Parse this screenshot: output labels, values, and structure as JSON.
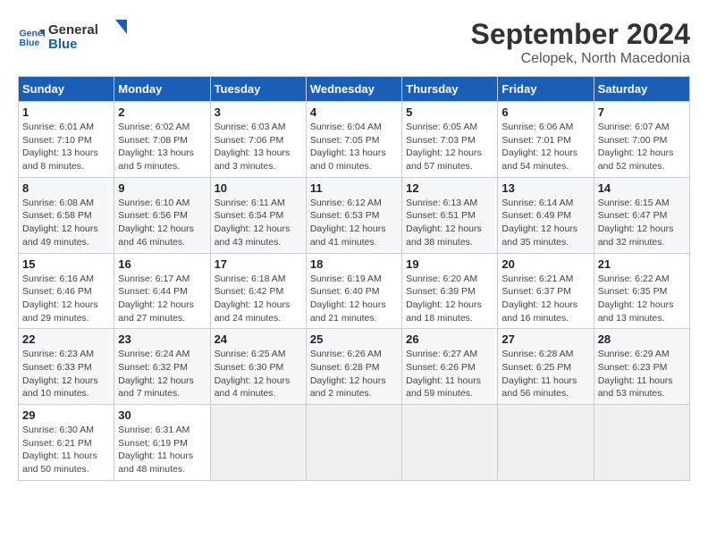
{
  "header": {
    "logo_line1": "General",
    "logo_line2": "Blue",
    "month": "September 2024",
    "location": "Celopek, North Macedonia"
  },
  "days_of_week": [
    "Sunday",
    "Monday",
    "Tuesday",
    "Wednesday",
    "Thursday",
    "Friday",
    "Saturday"
  ],
  "weeks": [
    [
      {
        "day": "1",
        "info": "Sunrise: 6:01 AM\nSunset: 7:10 PM\nDaylight: 13 hours and 8 minutes."
      },
      {
        "day": "2",
        "info": "Sunrise: 6:02 AM\nSunset: 7:08 PM\nDaylight: 13 hours and 5 minutes."
      },
      {
        "day": "3",
        "info": "Sunrise: 6:03 AM\nSunset: 7:06 PM\nDaylight: 13 hours and 3 minutes."
      },
      {
        "day": "4",
        "info": "Sunrise: 6:04 AM\nSunset: 7:05 PM\nDaylight: 13 hours and 0 minutes."
      },
      {
        "day": "5",
        "info": "Sunrise: 6:05 AM\nSunset: 7:03 PM\nDaylight: 12 hours and 57 minutes."
      },
      {
        "day": "6",
        "info": "Sunrise: 6:06 AM\nSunset: 7:01 PM\nDaylight: 12 hours and 54 minutes."
      },
      {
        "day": "7",
        "info": "Sunrise: 6:07 AM\nSunset: 7:00 PM\nDaylight: 12 hours and 52 minutes."
      }
    ],
    [
      {
        "day": "8",
        "info": "Sunrise: 6:08 AM\nSunset: 6:58 PM\nDaylight: 12 hours and 49 minutes."
      },
      {
        "day": "9",
        "info": "Sunrise: 6:10 AM\nSunset: 6:56 PM\nDaylight: 12 hours and 46 minutes."
      },
      {
        "day": "10",
        "info": "Sunrise: 6:11 AM\nSunset: 6:54 PM\nDaylight: 12 hours and 43 minutes."
      },
      {
        "day": "11",
        "info": "Sunrise: 6:12 AM\nSunset: 6:53 PM\nDaylight: 12 hours and 41 minutes."
      },
      {
        "day": "12",
        "info": "Sunrise: 6:13 AM\nSunset: 6:51 PM\nDaylight: 12 hours and 38 minutes."
      },
      {
        "day": "13",
        "info": "Sunrise: 6:14 AM\nSunset: 6:49 PM\nDaylight: 12 hours and 35 minutes."
      },
      {
        "day": "14",
        "info": "Sunrise: 6:15 AM\nSunset: 6:47 PM\nDaylight: 12 hours and 32 minutes."
      }
    ],
    [
      {
        "day": "15",
        "info": "Sunrise: 6:16 AM\nSunset: 6:46 PM\nDaylight: 12 hours and 29 minutes."
      },
      {
        "day": "16",
        "info": "Sunrise: 6:17 AM\nSunset: 6:44 PM\nDaylight: 12 hours and 27 minutes."
      },
      {
        "day": "17",
        "info": "Sunrise: 6:18 AM\nSunset: 6:42 PM\nDaylight: 12 hours and 24 minutes."
      },
      {
        "day": "18",
        "info": "Sunrise: 6:19 AM\nSunset: 6:40 PM\nDaylight: 12 hours and 21 minutes."
      },
      {
        "day": "19",
        "info": "Sunrise: 6:20 AM\nSunset: 6:39 PM\nDaylight: 12 hours and 18 minutes."
      },
      {
        "day": "20",
        "info": "Sunrise: 6:21 AM\nSunset: 6:37 PM\nDaylight: 12 hours and 16 minutes."
      },
      {
        "day": "21",
        "info": "Sunrise: 6:22 AM\nSunset: 6:35 PM\nDaylight: 12 hours and 13 minutes."
      }
    ],
    [
      {
        "day": "22",
        "info": "Sunrise: 6:23 AM\nSunset: 6:33 PM\nDaylight: 12 hours and 10 minutes."
      },
      {
        "day": "23",
        "info": "Sunrise: 6:24 AM\nSunset: 6:32 PM\nDaylight: 12 hours and 7 minutes."
      },
      {
        "day": "24",
        "info": "Sunrise: 6:25 AM\nSunset: 6:30 PM\nDaylight: 12 hours and 4 minutes."
      },
      {
        "day": "25",
        "info": "Sunrise: 6:26 AM\nSunset: 6:28 PM\nDaylight: 12 hours and 2 minutes."
      },
      {
        "day": "26",
        "info": "Sunrise: 6:27 AM\nSunset: 6:26 PM\nDaylight: 11 hours and 59 minutes."
      },
      {
        "day": "27",
        "info": "Sunrise: 6:28 AM\nSunset: 6:25 PM\nDaylight: 11 hours and 56 minutes."
      },
      {
        "day": "28",
        "info": "Sunrise: 6:29 AM\nSunset: 6:23 PM\nDaylight: 11 hours and 53 minutes."
      }
    ],
    [
      {
        "day": "29",
        "info": "Sunrise: 6:30 AM\nSunset: 6:21 PM\nDaylight: 11 hours and 50 minutes."
      },
      {
        "day": "30",
        "info": "Sunrise: 6:31 AM\nSunset: 6:19 PM\nDaylight: 11 hours and 48 minutes."
      },
      {
        "day": "",
        "info": ""
      },
      {
        "day": "",
        "info": ""
      },
      {
        "day": "",
        "info": ""
      },
      {
        "day": "",
        "info": ""
      },
      {
        "day": "",
        "info": ""
      }
    ]
  ]
}
